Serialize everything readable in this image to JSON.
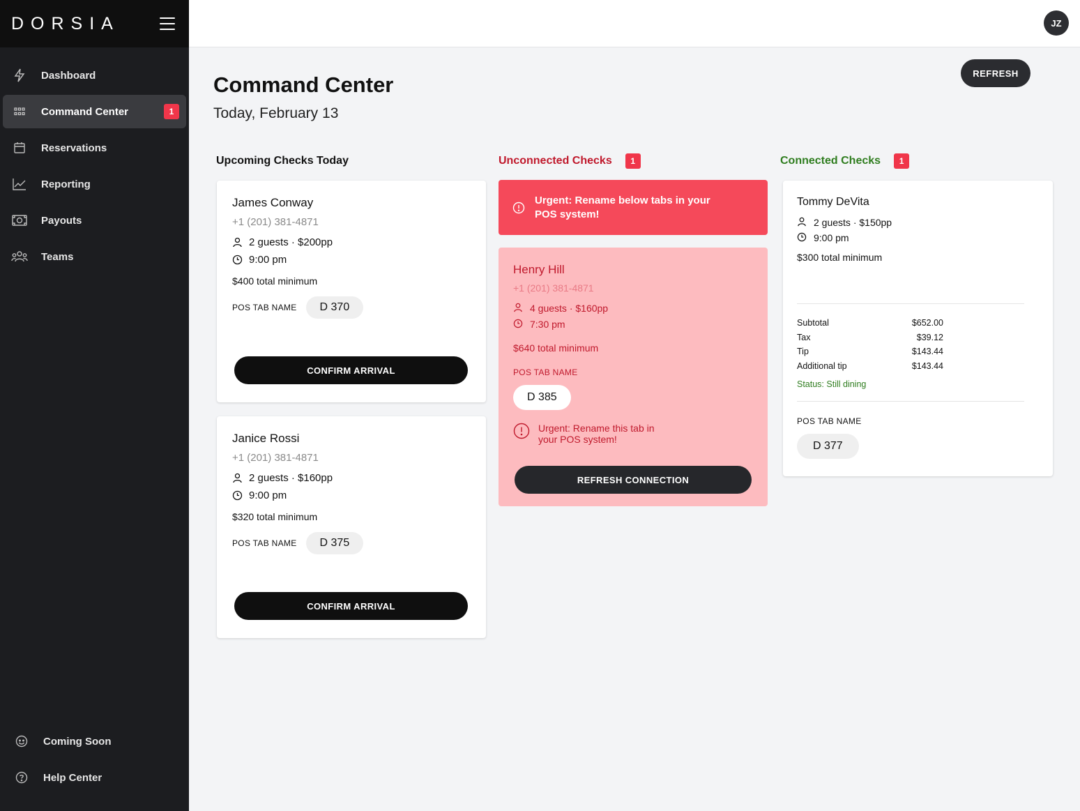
{
  "app": {
    "brand": "DORSIA"
  },
  "sidebar": {
    "items": [
      {
        "label": "Dashboard",
        "icon": "bolt-icon"
      },
      {
        "label": "Command Center",
        "icon": "grid-icon",
        "badge": "1",
        "active": true
      },
      {
        "label": "Reservations",
        "icon": "calendar-icon"
      },
      {
        "label": "Reporting",
        "icon": "chart-icon"
      },
      {
        "label": "Payouts",
        "icon": "cash-icon"
      },
      {
        "label": "Teams",
        "icon": "team-icon"
      }
    ],
    "bottom": [
      {
        "label": "Coming Soon",
        "icon": "emoji-icon"
      },
      {
        "label": "Help Center",
        "icon": "help-icon"
      }
    ]
  },
  "topbar": {
    "avatar_initials": "JZ"
  },
  "page": {
    "title": "Command Center",
    "date": "Today, February 13",
    "refresh_label": "REFRESH"
  },
  "columns": {
    "upcoming": {
      "heading": "Upcoming Checks Today"
    },
    "unconnected": {
      "heading": "Unconnected Checks",
      "badge": "1",
      "color": "#c0192c"
    },
    "connected": {
      "heading": "Connected Checks",
      "badge": "1",
      "color": "#2f7d1f"
    }
  },
  "upcoming": [
    {
      "name": "James Conway",
      "phone": "+1 (201) 381-4871",
      "guests": "2 guests · $200pp",
      "time": "9:00 pm",
      "minimum": "$400 total minimum",
      "pos_label": "POS TAB NAME",
      "tab": "D 370",
      "button": "CONFIRM ARRIVAL"
    },
    {
      "name": "Janice Rossi",
      "phone": "+1 (201) 381-4871",
      "guests": "2 guests · $160pp",
      "time": "9:00 pm",
      "minimum": "$320 total minimum",
      "pos_label": "POS TAB NAME",
      "tab": "D 375",
      "button": "CONFIRM ARRIVAL"
    }
  ],
  "unconnected": {
    "banner": "Urgent: Rename below tabs in your POS system!",
    "card": {
      "name": "Henry Hill",
      "phone": "+1 (201) 381-4871",
      "guests": "4 guests · $160pp",
      "time": "7:30 pm",
      "minimum": "$640 total minimum",
      "pos_label": "POS TAB NAME",
      "tab": "D 385",
      "warning": "Urgent: Rename this tab in your POS system!",
      "button": "REFRESH CONNECTION"
    }
  },
  "connected": {
    "name": "Tommy DeVita",
    "guests": "2 guests · $150pp",
    "time": "9:00 pm",
    "minimum": "$300 total minimum",
    "summary": [
      {
        "label": "Subtotal",
        "value": "$652.00"
      },
      {
        "label": "Tax",
        "value": "$39.12"
      },
      {
        "label": "Tip",
        "value": "$143.44"
      },
      {
        "label": "Additional tip",
        "value": "$143.44"
      }
    ],
    "status": "Status: Still dining",
    "pos_label": "POS TAB NAME",
    "tab": "D 377"
  }
}
